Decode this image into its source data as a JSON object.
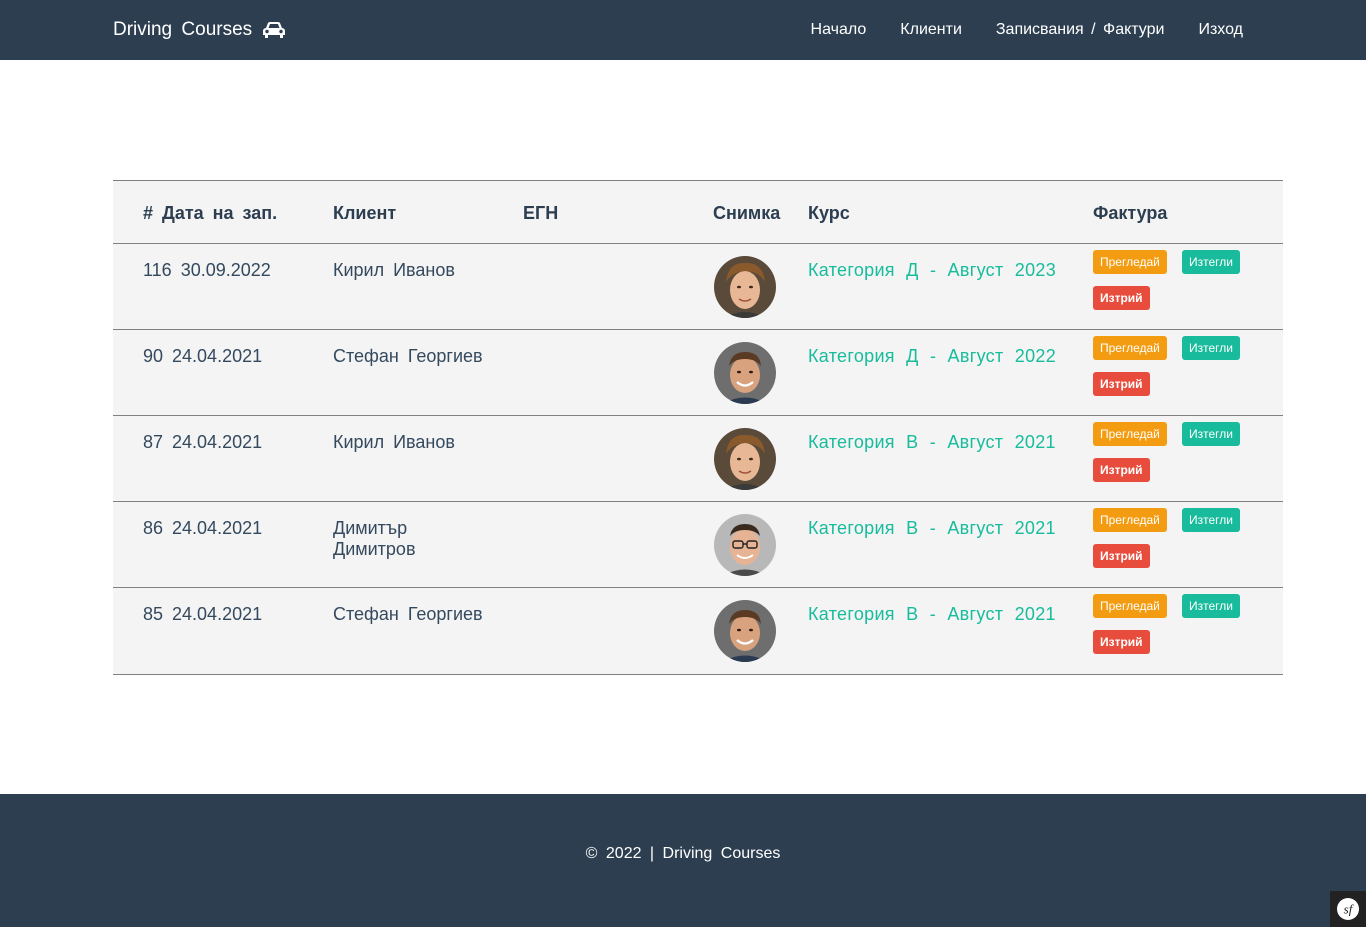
{
  "navbar": {
    "brand": "Driving Courses",
    "brand_icon": "car-icon",
    "links": [
      {
        "label": "Начало"
      },
      {
        "label": "Клиенти"
      },
      {
        "label": "Записвания / Фактури"
      },
      {
        "label": "Изход"
      }
    ]
  },
  "table": {
    "headers": {
      "num_date": "# Дата на зап.",
      "client": "Клиент",
      "egn": "ЕГН",
      "photo": "Снимка",
      "course": "Курс",
      "invoice": "Фактура"
    },
    "rows": [
      {
        "num_date": "116 30.09.2022",
        "client": "Кирил Иванов",
        "egn": "",
        "course": "Категория Д - Август 2023",
        "avatar": "avatar-1"
      },
      {
        "num_date": "90 24.04.2021",
        "client": "Стефан Георгиев",
        "egn": "",
        "course": "Категория Д - Август 2022",
        "avatar": "avatar-2"
      },
      {
        "num_date": "87 24.04.2021",
        "client": "Кирил Иванов",
        "egn": "",
        "course": "Категория В - Август 2021",
        "avatar": "avatar-1"
      },
      {
        "num_date": "86 24.04.2021",
        "client": "Димитър Димитров",
        "egn": "",
        "course": "Категория В - Август 2021",
        "avatar": "avatar-3"
      },
      {
        "num_date": "85 24.04.2021",
        "client": "Стефан Георгиев",
        "egn": "",
        "course": "Категория В - Август 2021",
        "avatar": "avatar-2"
      }
    ],
    "actions": {
      "view": "Прегледай",
      "download": "Изтегли",
      "delete": "Изтрий"
    }
  },
  "footer": {
    "text": "© 2022 | Driving Courses"
  },
  "colors": {
    "navbar_bg": "#2c3e50",
    "accent": "#18bc9c",
    "warning": "#f39c12",
    "danger": "#e74c3c",
    "table_bg": "#f4f4f4"
  }
}
